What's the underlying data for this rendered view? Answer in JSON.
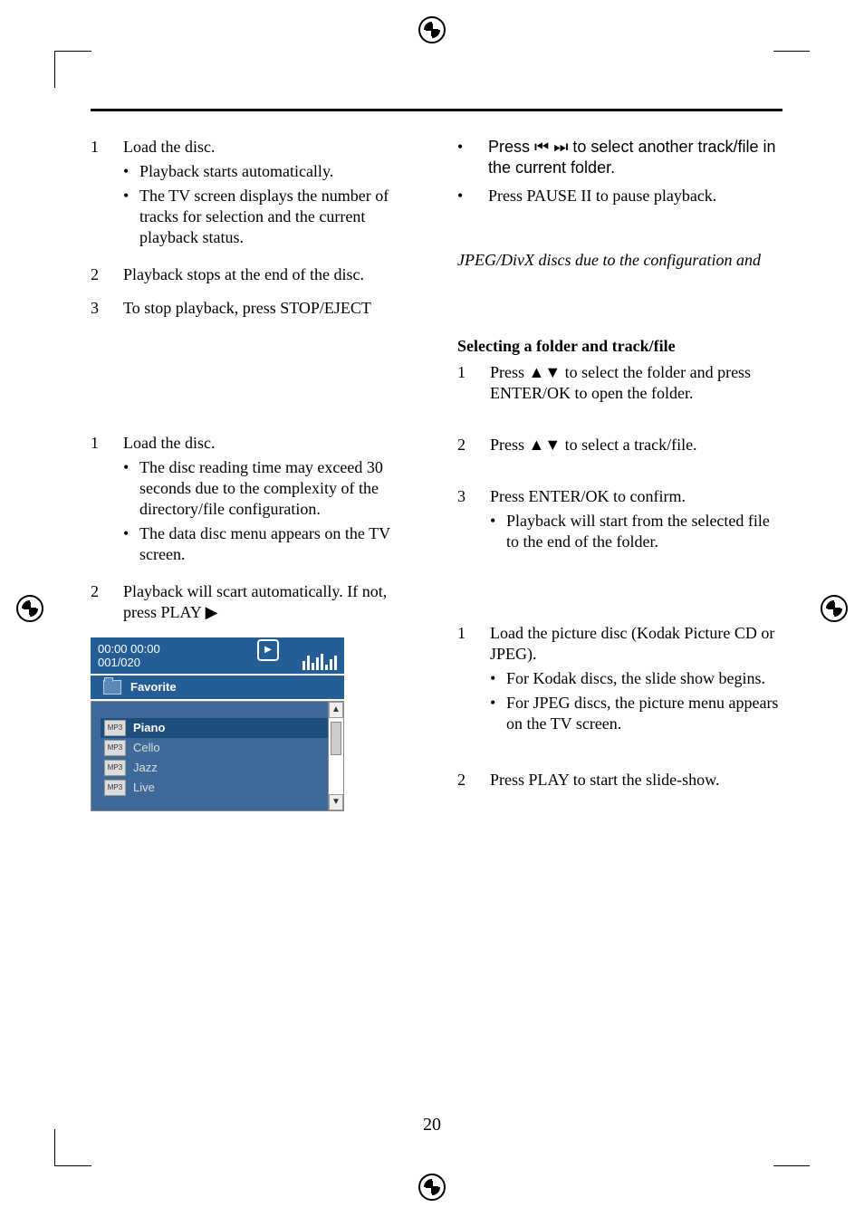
{
  "left": {
    "items_a": [
      {
        "n": "1",
        "text": "Load the disc.",
        "sub": [
          "Playback starts automatically.",
          "The TV screen displays the number of tracks for selection and the current playback status."
        ]
      },
      {
        "n": "2",
        "text": "Playback stops at the end of the disc."
      },
      {
        "n": "3",
        "text": "To stop playback, press STOP/EJECT"
      }
    ],
    "items_b": [
      {
        "n": "1",
        "text": "Load the disc.",
        "sub": [
          "The disc reading time may exceed 30 seconds due to the complexity of the directory/file configuration.",
          "The data disc menu appears on the TV screen."
        ]
      },
      {
        "n": "2",
        "text": "Playback will scart automatically. If not, press PLAY ▶"
      }
    ]
  },
  "right": {
    "bullets": [
      "Press ⏮  ⏭ to select another track/file in the current folder.",
      "Press PAUSE II to pause playback."
    ],
    "italic_line": "JPEG/DivX discs due to the configuration and",
    "heading": "Selecting a folder and track/file",
    "items_a": [
      {
        "n": "1",
        "text": "Press ▲▼ to select the folder and press ENTER/OK to open the folder."
      },
      {
        "n": "2",
        "text": "Press ▲▼ to select a track/file."
      },
      {
        "n": "3",
        "text": "Press ENTER/OK to confirm.",
        "sub": [
          "Playback will start from the selected file to the end of the folder."
        ]
      }
    ],
    "items_b": [
      {
        "n": "1",
        "text": "Load the picture disc (Kodak Picture CD or JPEG).",
        "sub": [
          "For Kodak discs, the slide show begins.",
          "For JPEG discs, the picture menu appears on the TV screen."
        ]
      },
      {
        "n": "2",
        "text": "Press PLAY to start the slide-show."
      }
    ]
  },
  "shot": {
    "time": "00:00  00:00",
    "counter": "001/020",
    "folder": "Favorite",
    "file_ext": "MP3",
    "tracks": [
      "Piano",
      "Cello",
      "Jazz",
      "Live"
    ]
  },
  "page_number": "20"
}
